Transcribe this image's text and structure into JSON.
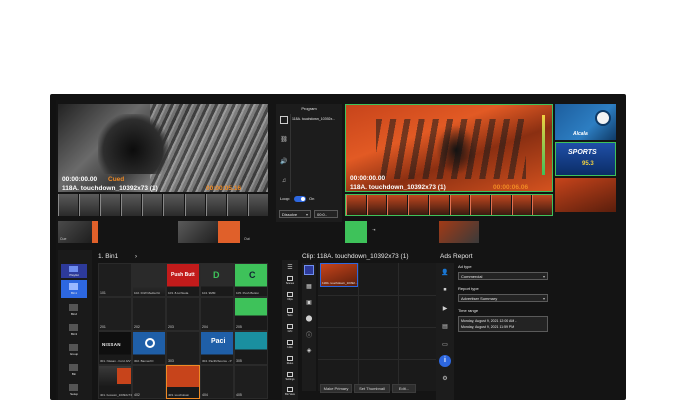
{
  "colors": {
    "accent_blue": "#2d67e0",
    "accent_green": "#3ec25a",
    "accent_orange": "#f08a24",
    "bezel": "#121212"
  },
  "preview": {
    "timecode_left": "00:00:00.00",
    "cued_label": "Cued",
    "clip_name": "118A. touchdown_10392x73 (1)",
    "timecode_right": "00:00:05.16"
  },
  "program_panel": {
    "header": "Program",
    "clip_label": "118A. touchdown_10392x...",
    "icons": [
      "playlist-icon",
      "link-icon",
      "volume-icon",
      "music-icon"
    ],
    "loop_label": "Loop:",
    "loop_state": "On",
    "transition": "Dissolve",
    "duration": "00:0.."
  },
  "program": {
    "timecode_left": "00:00:00.00",
    "clip_name": "118A. touchdown_10392x73 (1)",
    "timecode_right": "00:00:06.06"
  },
  "side_thumbs": {
    "t1_text": "Alcala",
    "t2_text": "SPORTS",
    "t2_sub": "95.3"
  },
  "under_preview": {
    "cue_label": "Cue",
    "out_label": "Out"
  },
  "left_rail": {
    "items": [
      {
        "label": "Playlist"
      },
      {
        "label": "Bin1"
      },
      {
        "label": "Bin2"
      },
      {
        "label": "Bin3"
      },
      {
        "label": "Group"
      },
      {
        "label": "Bin"
      },
      {
        "label": "Setup"
      }
    ]
  },
  "bin": {
    "title": "1. Bin1",
    "row1": [
      {
        "num": "101",
        "label": ""
      },
      {
        "num": "102",
        "label": "102. DrW Media Kit"
      },
      {
        "num": "103",
        "label": "103. 8-lvchleda"
      },
      {
        "num": "104",
        "label": "104. 9MM"
      },
      {
        "num": "105",
        "label": "105. Push Button"
      }
    ],
    "row1_tile_text": {
      "push_button": "Push Butt",
      "brand_d": "D",
      "brand_c": "C"
    },
    "row2": [
      {
        "num": "201",
        "label": ""
      },
      {
        "num": "202",
        "label": ""
      },
      {
        "num": "203",
        "label": ""
      },
      {
        "num": "204",
        "label": ""
      },
      {
        "num": "205",
        "label": "205"
      }
    ],
    "row3": [
      {
        "num": "301",
        "label": "301. Nissan - Ford J2V"
      },
      {
        "num": "302",
        "label": "302. BannerIO"
      },
      {
        "num": "303",
        "label": ""
      },
      {
        "num": "304",
        "label": "304. PacificSource - P"
      },
      {
        "num": "305",
        "label": "305"
      }
    ],
    "row3_tile_text": {
      "nissan": "NISSAN",
      "pacific": "Paci"
    },
    "row4": [
      {
        "num": "401",
        "label": "401. bossoin_10392x73"
      },
      {
        "num": "402",
        "label": ""
      },
      {
        "num": "403",
        "label": "403. touchdown"
      },
      {
        "num": "404",
        "label": "404"
      },
      {
        "num": "405",
        "label": "405"
      }
    ]
  },
  "mid_rail": {
    "items": [
      "Scenes",
      "Clips",
      "Sets",
      "Grfx",
      "Lists",
      "Rules",
      "",
      "",
      "",
      "Settings",
      "Bin View"
    ]
  },
  "clip": {
    "title": "Clip: 118A. touchdown_10392x73 (1)",
    "tile_label": "118A. touchdown_10392...",
    "buttons": {
      "make_primary": "Make Primary",
      "set_thumbnail": "Set Thumbnail",
      "edit": "Edit..."
    }
  },
  "ads_report": {
    "title": "Ads Report",
    "ad_type_label": "Ad type",
    "ad_type_value": "Commercial",
    "report_type_label": "Report type",
    "report_type_value": "Advertiser Summary",
    "time_range_label": "Time range",
    "time_from": "Monday, August 9, 2021 12:00 AM -",
    "time_to": "Monday, August 9, 2021 11:59 PM",
    "icons": [
      "user-icon",
      "stop-icon",
      "play-circle-icon",
      "calendar-icon",
      "folder-icon",
      "info-icon",
      "user-settings-icon"
    ]
  }
}
